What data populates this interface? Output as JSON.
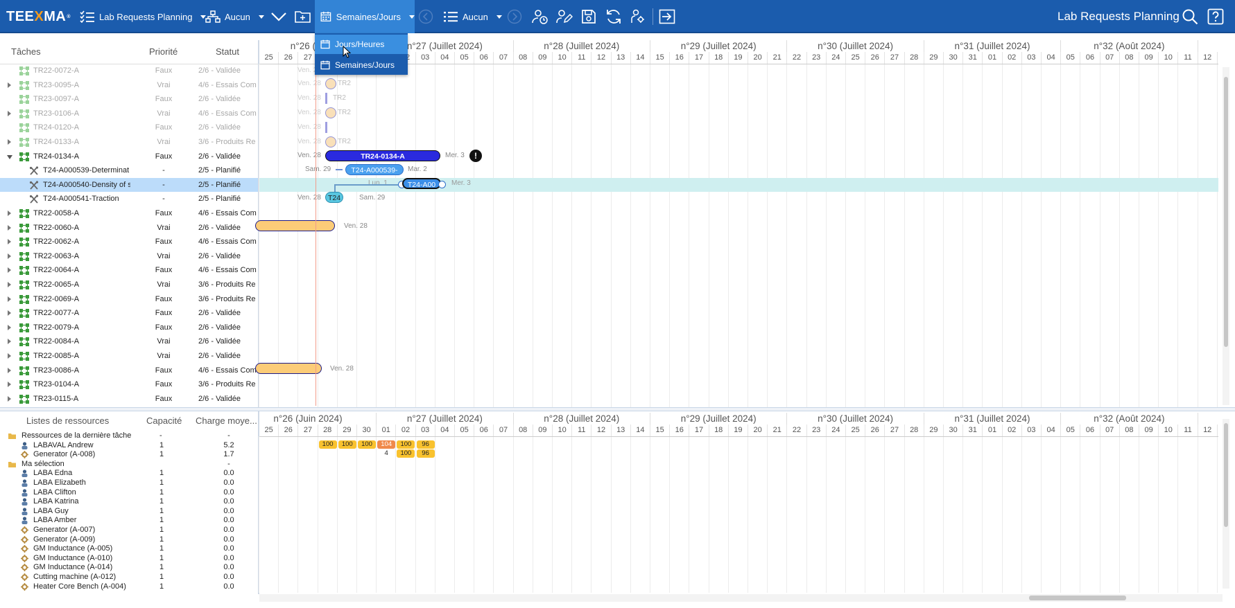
{
  "toolbar": {
    "logo_text": "TEEXMA",
    "planning_label": "Lab Requests Planning",
    "group_label": "Aucun",
    "view_mode_label": "Semaines/Jours",
    "list_label": "Aucun",
    "app_title": "Lab Requests Planning",
    "accent_color": "#1b5cad"
  },
  "view_menu": {
    "options": [
      "Jours/Heures",
      "Semaines/Jours"
    ]
  },
  "task_panel": {
    "columns": [
      "Tâches",
      "Priorité",
      "Statut"
    ],
    "rows": [
      {
        "name": "TR22-0072-A",
        "priority": "Faux",
        "status": "2/6 - Validée"
      },
      {
        "name": "TR23-0095-A",
        "priority": "Vrai",
        "status": "4/6 - Essais Com"
      },
      {
        "name": "TR23-0097-A",
        "priority": "Faux",
        "status": "2/6 - Validée"
      },
      {
        "name": "TR23-0106-A",
        "priority": "Vrai",
        "status": "4/6 - Essais Com"
      },
      {
        "name": "TR24-0120-A",
        "priority": "Faux",
        "status": "2/6 - Validée"
      },
      {
        "name": "TR24-0133-A",
        "priority": "Vrai",
        "status": "3/6 - Produits Re"
      },
      {
        "name": "TR24-0134-A",
        "priority": "Faux",
        "status": "2/6 - Validée"
      },
      {
        "name": "T24-A000539-Determinat",
        "priority": "-",
        "status": "2/5 - Planifié"
      },
      {
        "name": "T24-A000540-Density of s",
        "priority": "-",
        "status": "2/5 - Planifié"
      },
      {
        "name": "T24-A000541-Traction",
        "priority": "-",
        "status": "2/5 - Planifié"
      },
      {
        "name": "TR22-0058-A",
        "priority": "Faux",
        "status": "4/6 - Essais Com"
      },
      {
        "name": "TR22-0060-A",
        "priority": "Vrai",
        "status": "2/6 - Validée"
      },
      {
        "name": "TR22-0062-A",
        "priority": "Faux",
        "status": "4/6 - Essais Com"
      },
      {
        "name": "TR22-0063-A",
        "priority": "Vrai",
        "status": "2/6 - Validée"
      },
      {
        "name": "TR22-0064-A",
        "priority": "Faux",
        "status": "4/6 - Essais Com"
      },
      {
        "name": "TR22-0065-A",
        "priority": "Vrai",
        "status": "3/6 - Produits Re"
      },
      {
        "name": "TR22-0069-A",
        "priority": "Faux",
        "status": "3/6 - Produits Re"
      },
      {
        "name": "TR22-0077-A",
        "priority": "Faux",
        "status": "2/6 - Validée"
      },
      {
        "name": "TR22-0079-A",
        "priority": "Faux",
        "status": "2/6 - Validée"
      },
      {
        "name": "TR22-0084-A",
        "priority": "Vrai",
        "status": "2/6 - Validée"
      },
      {
        "name": "TR22-0085-A",
        "priority": "Vrai",
        "status": "2/6 - Validée"
      },
      {
        "name": "TR23-0086-A",
        "priority": "Faux",
        "status": "4/6 - Essais Com"
      },
      {
        "name": "TR23-0104-A",
        "priority": "Faux",
        "status": "3/6 - Produits Re"
      },
      {
        "name": "TR23-0115-A",
        "priority": "Faux",
        "status": "2/6 - Validée"
      }
    ]
  },
  "timeline": {
    "weeks": [
      "n°26 (Juin 2024)",
      "n°27 (Juillet 2024)",
      "n°28 (Juillet 2024)",
      "n°29 (Juillet 2024)",
      "n°30 (Juillet 2024)",
      "n°31 (Juillet 2024)",
      "n°32 (Août 2024)"
    ],
    "week_top_partial": "n°26 (Ju",
    "days": [
      "25",
      "26",
      "27",
      "28",
      "29",
      "30",
      "01",
      "02",
      "03",
      "04",
      "05",
      "06",
      "07",
      "08",
      "09",
      "10",
      "11",
      "12",
      "13",
      "14",
      "15",
      "16",
      "17",
      "18",
      "19",
      "20",
      "21",
      "22",
      "23",
      "24",
      "25",
      "26",
      "27",
      "28",
      "29",
      "30",
      "31",
      "01",
      "02",
      "03",
      "04",
      "05",
      "06",
      "07",
      "08",
      "09",
      "10",
      "11",
      "12"
    ]
  },
  "gantt": {
    "parent_bar_label": "TR24-0134-A",
    "sub_bar_1_label": "T24-A000539-",
    "sub_bar_2_label": "T24-A00",
    "sub_bar_3_label": "T24",
    "labels": {
      "ven28": "Ven. 28",
      "mer3": "Mer. 3",
      "sam29": "Sam. 29",
      "mar2": "Mar. 2",
      "lun1": "Lun. 1",
      "tr_short": "TR2"
    }
  },
  "resource_panel": {
    "columns": [
      "Listes de ressources",
      "Capacité",
      "Charge moye..."
    ],
    "rows": [
      {
        "name": "Ressources de la dernière tâche",
        "capacity": "-",
        "load": "-",
        "type": "folder"
      },
      {
        "name": "LABAVAL Andrew",
        "capacity": "1",
        "load": "5.2",
        "type": "person"
      },
      {
        "name": "Generator (A-008)",
        "capacity": "1",
        "load": "1.7",
        "type": "equipment"
      },
      {
        "name": "Ma sélection",
        "capacity": "",
        "load": "-",
        "type": "folder"
      },
      {
        "name": "LABA Edna",
        "capacity": "1",
        "load": "0.0",
        "type": "person"
      },
      {
        "name": "LABA Elizabeth",
        "capacity": "1",
        "load": "0.0",
        "type": "person"
      },
      {
        "name": "LABA Clifton",
        "capacity": "1",
        "load": "0.0",
        "type": "person"
      },
      {
        "name": "LABA Katrina",
        "capacity": "1",
        "load": "0.0",
        "type": "person"
      },
      {
        "name": "LABA Guy",
        "capacity": "1",
        "load": "0.0",
        "type": "person"
      },
      {
        "name": "LABA Amber",
        "capacity": "1",
        "load": "0.0",
        "type": "person"
      },
      {
        "name": "Generator (A-007)",
        "capacity": "1",
        "load": "0.0",
        "type": "equipment"
      },
      {
        "name": "Generator (A-009)",
        "capacity": "1",
        "load": "0.0",
        "type": "equipment"
      },
      {
        "name": "GM Inductance (A-005)",
        "capacity": "1",
        "load": "0.0",
        "type": "equipment"
      },
      {
        "name": "GM Inductance (A-010)",
        "capacity": "1",
        "load": "0.0",
        "type": "equipment"
      },
      {
        "name": "GM Inductance (A-014)",
        "capacity": "1",
        "load": "0.0",
        "type": "equipment"
      },
      {
        "name": "Cutting machine (A-012)",
        "capacity": "1",
        "load": "0.0",
        "type": "equipment"
      },
      {
        "name": "Heater Core Bench (A-004)",
        "capacity": "1",
        "load": "0.0",
        "type": "equipment"
      }
    ]
  },
  "load_chart": {
    "andrew": [
      "100",
      "100",
      "100",
      "104",
      "100",
      "96"
    ],
    "generator_a008": [
      "4",
      "100",
      "96"
    ]
  }
}
